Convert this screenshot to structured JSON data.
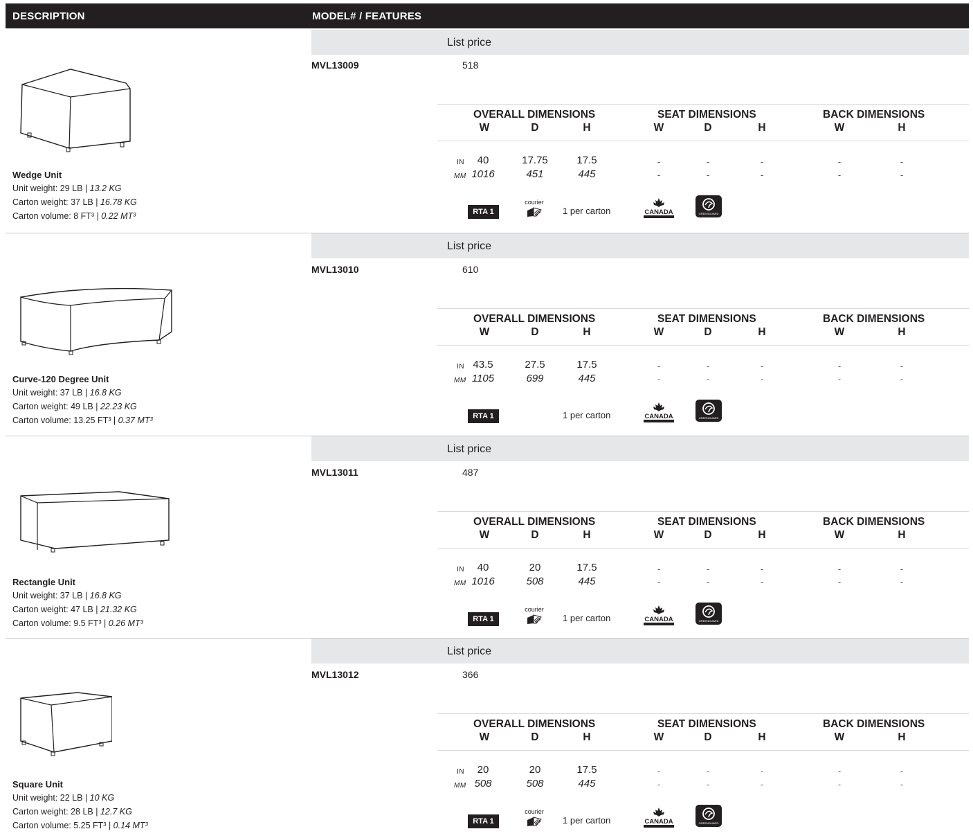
{
  "header": {
    "description": "DESCRIPTION",
    "model_features": "MODEL# / FEATURES"
  },
  "labels": {
    "list_price": "List price",
    "overall": "OVERALL DIMENSIONS",
    "seat": "SEAT DIMENSIONS",
    "back": "BACK DIMENSIONS",
    "w": "W",
    "d": "D",
    "h": "H",
    "in": "IN",
    "mm": "MM",
    "rta": "RTA 1",
    "courier": "courier",
    "per_carton": "1 per carton",
    "dash": "-"
  },
  "icons": [
    "rta-badge",
    "courier-box-icon",
    "made-in-canada-logo",
    "greenguard-logo"
  ],
  "products": [
    {
      "model": "MVL13009",
      "price": "518",
      "name": "Wedge Unit",
      "unit_weight": "Unit weight: 29 LB | ",
      "unit_weight_metric": "13.2 KG",
      "carton_weight": "Carton weight: 37 LB | ",
      "carton_weight_metric": "16.78 KG",
      "carton_volume": "Carton volume: 8 FT³ | ",
      "carton_volume_metric": "0.22 MT³",
      "in": {
        "w": "40",
        "d": "17.75",
        "h": "17.5"
      },
      "mm": {
        "w": "1016",
        "d": "451",
        "h": "445"
      },
      "courier": true
    },
    {
      "model": "MVL13010",
      "price": "610",
      "name": "Curve-120 Degree Unit",
      "unit_weight": "Unit weight: 37 LB | ",
      "unit_weight_metric": "16.8 KG",
      "carton_weight": "Carton weight: 49 LB | ",
      "carton_weight_metric": "22.23 KG",
      "carton_volume": "Carton volume: 13.25 FT³ | ",
      "carton_volume_metric": "0.37 MT³",
      "in": {
        "w": "43.5",
        "d": "27.5",
        "h": "17.5"
      },
      "mm": {
        "w": "1105",
        "d": "699",
        "h": "445"
      },
      "courier": false
    },
    {
      "model": "MVL13011",
      "price": "487",
      "name": "Rectangle Unit",
      "unit_weight": "Unit weight: 37 LB | ",
      "unit_weight_metric": "16.8 KG",
      "carton_weight": "Carton weight: 47 LB | ",
      "carton_weight_metric": "21.32 KG",
      "carton_volume": "Carton volume: 9.5 FT³ | ",
      "carton_volume_metric": "0.26 MT³",
      "in": {
        "w": "40",
        "d": "20",
        "h": "17.5"
      },
      "mm": {
        "w": "1016",
        "d": "508",
        "h": "445"
      },
      "courier": true
    },
    {
      "model": "MVL13012",
      "price": "366",
      "name": "Square Unit",
      "unit_weight": "Unit weight: 22 LB | ",
      "unit_weight_metric": "10 KG",
      "carton_weight": "Carton weight: 28 LB | ",
      "carton_weight_metric": "12.7 KG",
      "carton_volume": "Carton volume: 5.25 FT³ | ",
      "carton_volume_metric": "0.14 MT³",
      "in": {
        "w": "20",
        "d": "20",
        "h": "17.5"
      },
      "mm": {
        "w": "508",
        "d": "508",
        "h": "445"
      },
      "courier": true
    }
  ]
}
